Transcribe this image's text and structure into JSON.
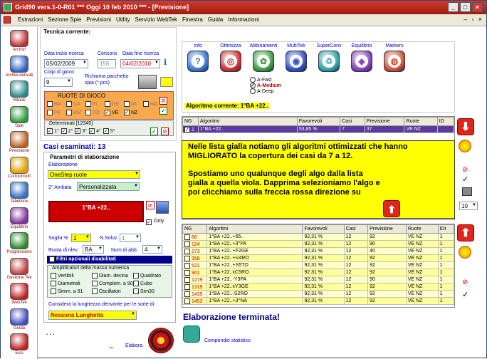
{
  "window": {
    "title": "Grid90 vers.1-0-R01   ***  Oggi 10 feb 2010  ***   - [Previsione]"
  },
  "menu": [
    "Estrazioni",
    "Sezione Spie",
    "Previsioni",
    "Utility",
    "Servizio WebTek",
    "Finestra",
    "Guida",
    "Informazioni"
  ],
  "sidebar": [
    "Archivi",
    "Archivi derivati",
    "Ritardi",
    "Spie",
    "Previsione",
    "Cortocircuiti",
    "Tabellone",
    "Equilibrio",
    "Progressione",
    "Gestione Tek",
    "WebTek",
    "Guida",
    "Esci"
  ],
  "tecnica": {
    "heading": "Tecnica corrente:",
    "data_inizio_label": "Data inizio ricerca",
    "data_inizio": "05/02/2009",
    "concorsi_label": "Concorsi",
    "concorsi": "156",
    "data_fine_label": "Data fine ricerca",
    "data_fine": "04/02/2010",
    "colpi_label": "Colpi di gioco",
    "colpi": "9",
    "pacchetto_label": "Richiama pacchetto spia (*.pcs)",
    "ruote_heading": "RUOTE DI GIOCO",
    "ruote": [
      "BA",
      "CA",
      "FI",
      "GE",
      "MI",
      "NA",
      "PA",
      "RM",
      "TO",
      "VE",
      "NZ"
    ],
    "ruote_on": [
      "VE",
      "NZ"
    ],
    "determinati_label": "Determinati [12345]",
    "determinati": [
      "1°",
      "2°",
      "3°",
      "4°",
      "5°"
    ],
    "casi_label": "Casi esaminati: 13"
  },
  "parametri": {
    "heading": "Parametri di elaborazione",
    "elab_label": "Elaborazione",
    "elab_value": "OneStep ruote",
    "ambata_label": "2° Ambata",
    "ambata_value": "Personalizzata",
    "selected": "1°BA +22..",
    "only_label": "Only",
    "soglia_label": "Soglia %",
    "soglia_value": "1",
    "nsoluz_label": "N.Soluz.",
    "nsoluz_value": "1",
    "ruota_label": "Ruota di rilev.",
    "ruota_value": "BA",
    "numabb_label": "Num di abb.",
    "numabb_value": "4",
    "filtri_label": "Filtri opzionali disabilitati",
    "ampl_label": "Amplificatori della massa numerica",
    "ampl": [
      [
        "Vertibili",
        "Diam. decina",
        "Quadrato"
      ],
      [
        "Diametrali",
        "Complem. a 90",
        "Cubo"
      ],
      [
        "Simm. a 91",
        "Oscillatori",
        "Sim30"
      ]
    ],
    "lunghezza_label": "Considera la lunghezza derivante per le sorte di:",
    "lunghezza_value": "Nessuna Lunghetta",
    "dots1": ". . .",
    "dots2": "...",
    "elabora": "Elabora"
  },
  "algoritmi": {
    "names": [
      "Info",
      "Ottimizza",
      "Abbinamenti",
      "MultiTek",
      "SuperConv",
      "Equilibrio",
      "Markers"
    ],
    "fast": "A-Fast",
    "medium": "A-Medium",
    "deep": "A-Deep",
    "corrente": "Algoritmo corrente: 1°BA +22.."
  },
  "purple_table": {
    "headers": [
      "NG",
      "Algoritmi",
      "Favorevoli",
      "Casi",
      "Previsione",
      "Ruote",
      "ID"
    ],
    "rows": [
      [
        "1",
        "1°BA +22..",
        "53,85 %",
        "7",
        "37",
        "VE NZ",
        ""
      ]
    ]
  },
  "note": {
    "p1": "Nelle lista gialla notiamo gli algoritmi ottimizzati che hanno MIGLIORATO la copertura dei casi da 7 a 12.",
    "p2": "Spostiamo uno qualunque degli algo dalla lista gialla a quella viola. Dapprima selezioniamo l'algo e poi clicchiamo sulla freccia rossa direzione su"
  },
  "yellow_table": {
    "headers": [
      "NG",
      "Algoritmi",
      "Favorevoli",
      "Casi",
      "Previsione",
      "Ruote",
      "IDt"
    ],
    "rows": [
      [
        "66",
        "1°BA +22..+65..",
        "92,31 %",
        "12",
        "92",
        "VE NZ",
        "1"
      ],
      [
        "124",
        "1°BA +22..+3°PA",
        "92,31 %",
        "12",
        "90",
        "VE NZ",
        "1"
      ],
      [
        "273",
        "1°BA +22..+F2GE",
        "92,31 %",
        "12",
        "40",
        "VE NZ",
        "1"
      ],
      [
        "358",
        "1°BA +22..+V4RO",
        "92,31 %",
        "12",
        "92",
        "VE NZ",
        "1"
      ],
      [
        "521",
        "1°BA +22..+S5TO",
        "92,31 %",
        "12",
        "92",
        "VE NZ",
        "1"
      ],
      [
        "901",
        "1°BA +22..xC5RO",
        "92,31 %",
        "12",
        "92",
        "VE NZ",
        "1"
      ],
      [
        "1279",
        "1°BA +22..-Y3PA",
        "92,31 %",
        "12",
        "90",
        "VE NZ",
        "1"
      ],
      [
        "1319",
        "1°BA +22..xY3GE",
        "92,31 %",
        "12",
        "92",
        "VE NZ",
        "1"
      ],
      [
        "1415",
        "1°BA +22..-S2RO",
        "92,31 %",
        "12",
        "92",
        "VE NZ",
        "1"
      ],
      [
        "1453",
        "1°BA +22..+3°NA",
        "92,31 %",
        "12",
        "92",
        "VE NZ",
        "1"
      ]
    ]
  },
  "status": "Elaborazione terminata!",
  "compendio": "Compendio statistico",
  "right_sel": "10"
}
